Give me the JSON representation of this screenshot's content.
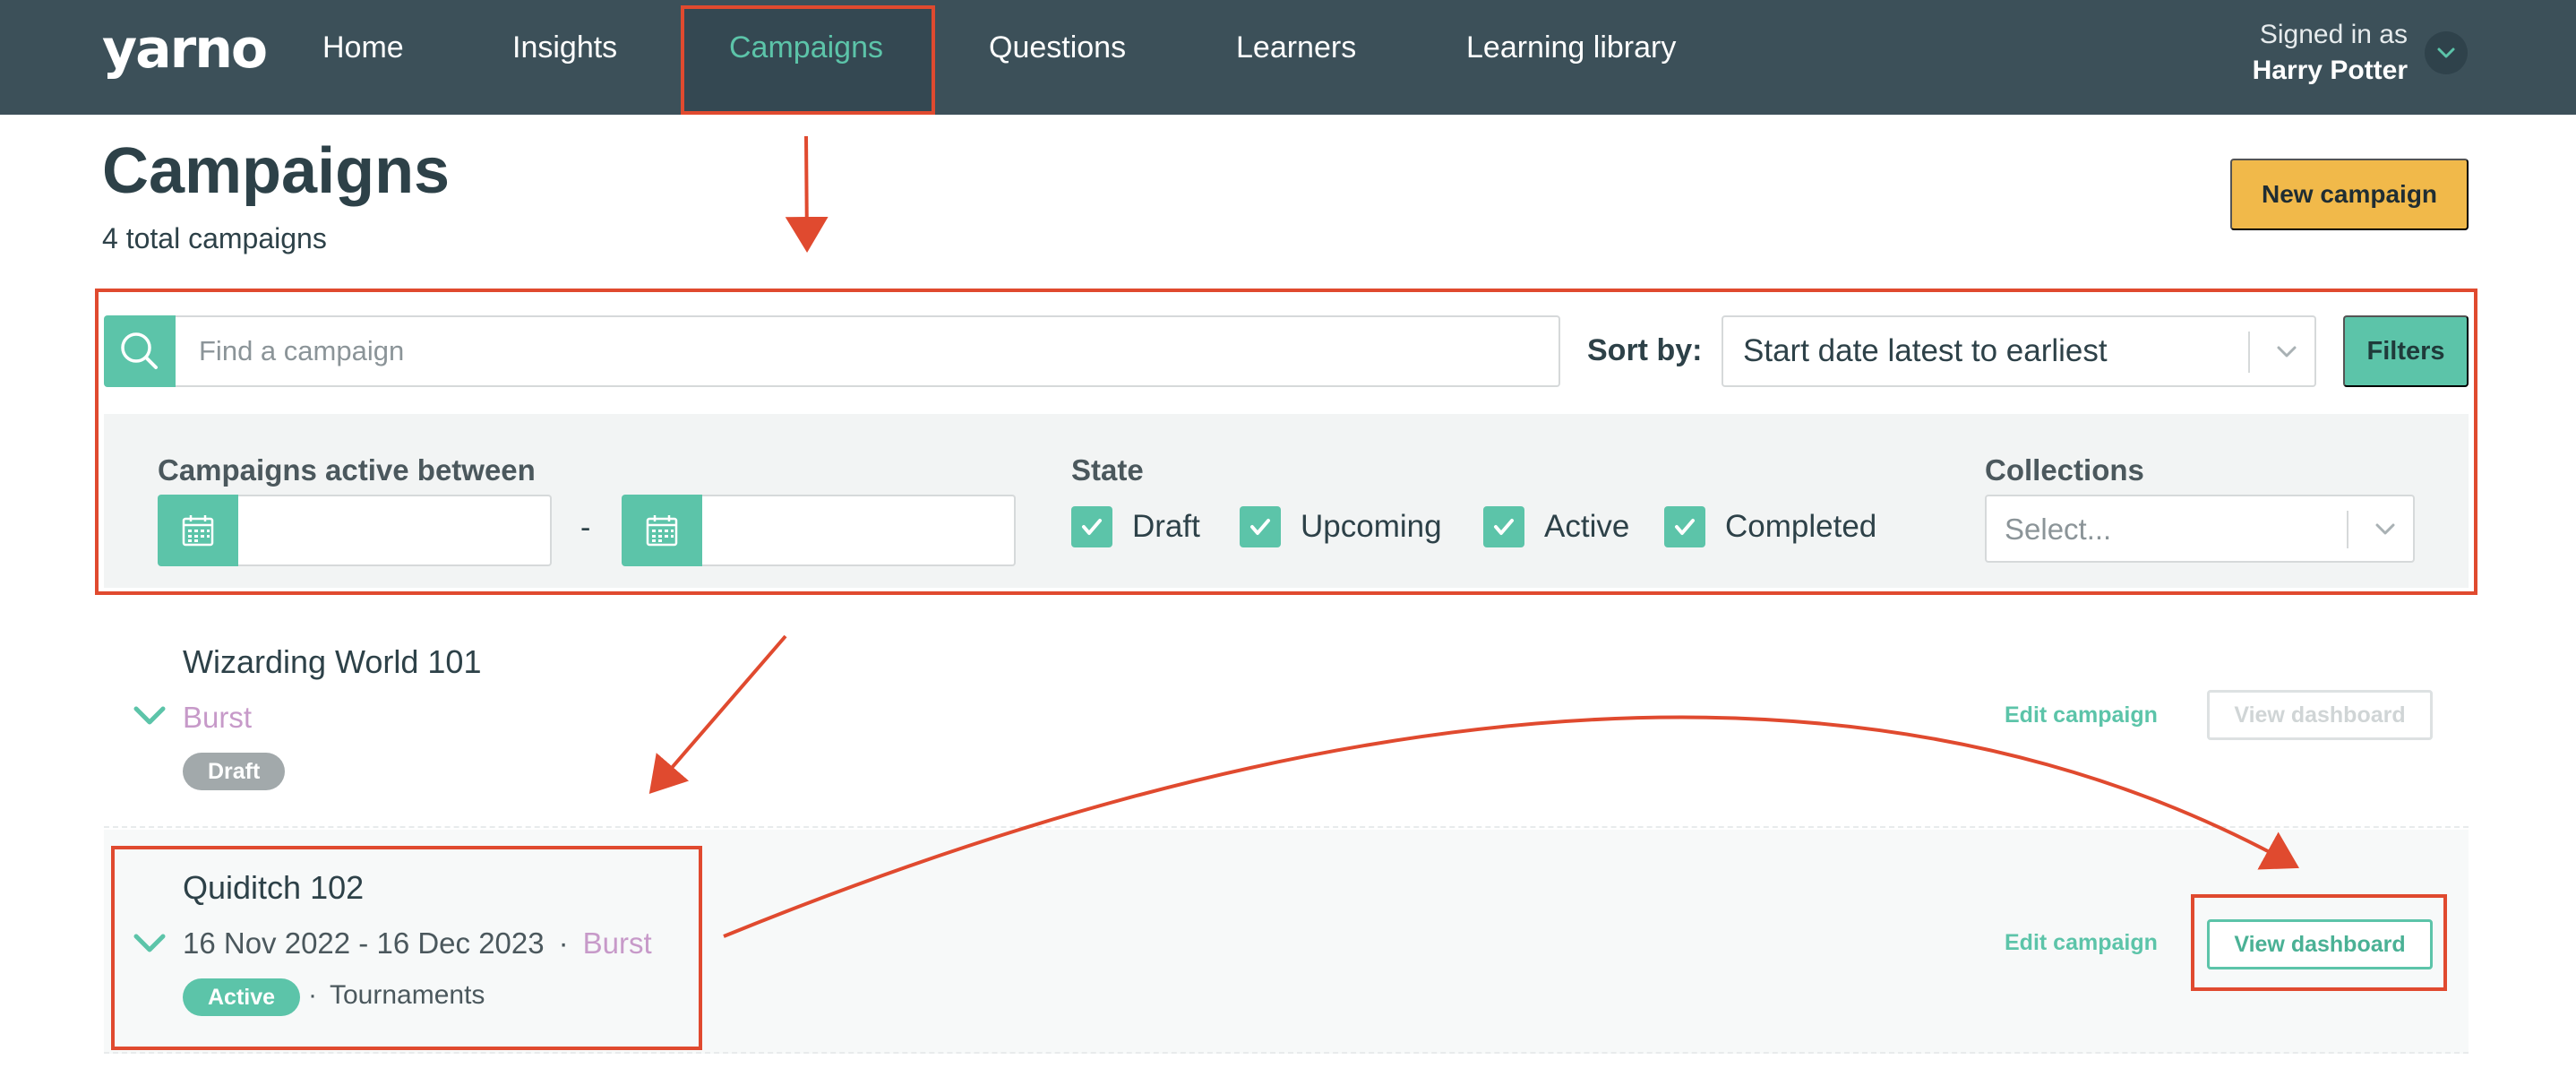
{
  "nav": {
    "logo": "yarno",
    "items": [
      {
        "label": "Home"
      },
      {
        "label": "Insights"
      },
      {
        "label": "Campaigns"
      },
      {
        "label": "Questions"
      },
      {
        "label": "Learners"
      },
      {
        "label": "Learning library"
      }
    ],
    "active_item": "Campaigns",
    "user": {
      "signed_in_label": "Signed in as",
      "name": "Harry Potter"
    }
  },
  "header": {
    "title": "Campaigns",
    "subtitle": "4 total campaigns",
    "new_button": "New campaign"
  },
  "search": {
    "placeholder": "Find a campaign",
    "value": ""
  },
  "sort": {
    "label": "Sort by:",
    "value": "Start date latest to earliest"
  },
  "filters_button": "Filters",
  "filters": {
    "date_label": "Campaigns active between",
    "date_separator": "-",
    "date_from": "",
    "date_to": "",
    "state_label": "State",
    "states": [
      {
        "label": "Draft",
        "checked": true
      },
      {
        "label": "Upcoming",
        "checked": true
      },
      {
        "label": "Active",
        "checked": true
      },
      {
        "label": "Completed",
        "checked": true
      }
    ],
    "collections_label": "Collections",
    "collections_placeholder": "Select..."
  },
  "campaigns": [
    {
      "name": "Wizarding World 101",
      "dates": "",
      "type": "Burst",
      "status": "Draft",
      "collection": "",
      "edit_label": "Edit campaign",
      "dashboard_label": "View dashboard",
      "dashboard_enabled": false
    },
    {
      "name": "Quiditch 102",
      "dates": "16 Nov 2022 - 16 Dec 2023",
      "separator": "·",
      "type": "Burst",
      "status": "Active",
      "collection": "Tournaments",
      "edit_label": "Edit campaign",
      "dashboard_label": "View dashboard",
      "dashboard_enabled": true
    }
  ],
  "colors": {
    "nav_bg": "#3c5059",
    "accent": "#5cc4a9",
    "primary_button": "#f1b94a",
    "burst_type": "#c79ac9",
    "annotation": "#e04a2f",
    "draft_badge": "#a2a9ab"
  },
  "icons": {
    "search": "search-icon",
    "calendar": "calendar-icon",
    "checkbox": "check-icon",
    "dropdown": "chevron-down-icon",
    "row_toggle": "chevron-down-icon"
  }
}
